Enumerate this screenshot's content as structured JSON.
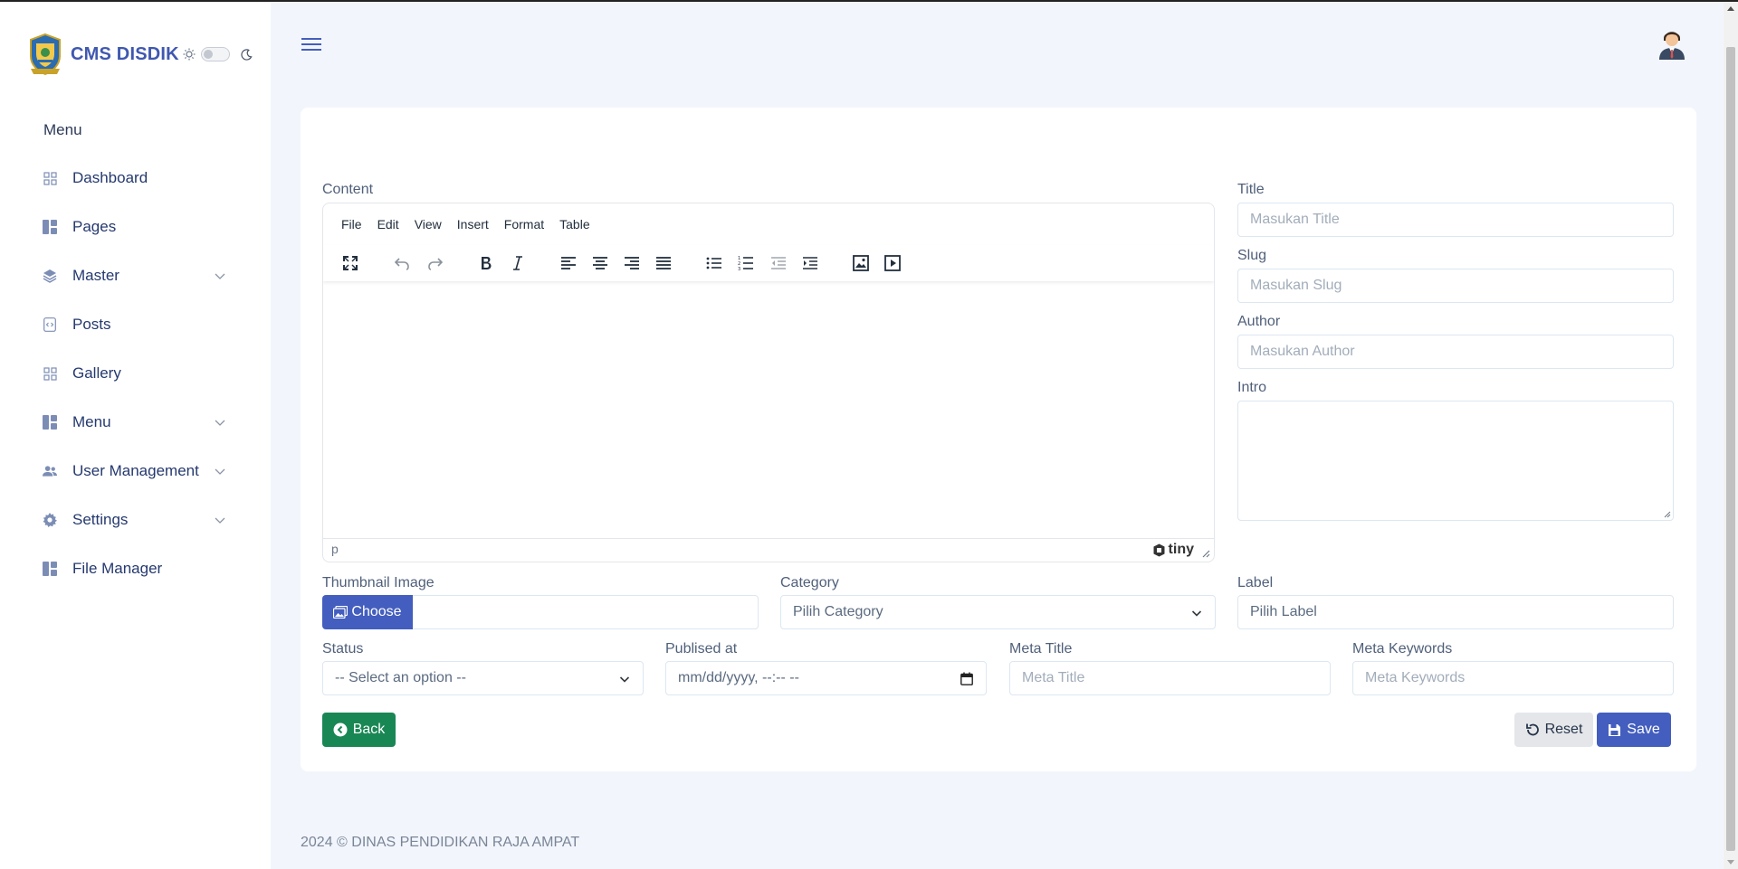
{
  "app": {
    "brand": "CMS DISDIK",
    "accent_color": "#435ebe",
    "success_color": "#198754"
  },
  "sidebar": {
    "menu_heading": "Menu",
    "items": [
      {
        "label": "Dashboard",
        "icon": "grid-icon",
        "has_submenu": false
      },
      {
        "label": "Pages",
        "icon": "layout-icon",
        "has_submenu": false
      },
      {
        "label": "Master",
        "icon": "layers-icon",
        "has_submenu": true
      },
      {
        "label": "Posts",
        "icon": "file-code-icon",
        "has_submenu": false
      },
      {
        "label": "Gallery",
        "icon": "grid-icon",
        "has_submenu": false
      },
      {
        "label": "Menu",
        "icon": "layout-icon",
        "has_submenu": true
      },
      {
        "label": "User Management",
        "icon": "people-icon",
        "has_submenu": true
      },
      {
        "label": "Settings",
        "icon": "gear-icon",
        "has_submenu": true
      },
      {
        "label": "File Manager",
        "icon": "layout-icon",
        "has_submenu": false
      }
    ]
  },
  "form": {
    "content_label": "Content",
    "editor": {
      "menus": [
        "File",
        "Edit",
        "View",
        "Insert",
        "Format",
        "Table"
      ],
      "status_path": "p",
      "brand": "tiny"
    },
    "title": {
      "label": "Title",
      "placeholder": "Masukan Title"
    },
    "slug": {
      "label": "Slug",
      "placeholder": "Masukan Slug"
    },
    "author": {
      "label": "Author",
      "placeholder": "Masukan Author"
    },
    "intro": {
      "label": "Intro"
    },
    "thumbnail": {
      "label": "Thumbnail Image",
      "button": "Choose"
    },
    "category": {
      "label": "Category",
      "value": "Pilih Category"
    },
    "label_field": {
      "label": "Label",
      "value": "Pilih Label"
    },
    "status": {
      "label": "Status",
      "value": "-- Select an option --"
    },
    "published_at": {
      "label": "Publised at",
      "value": "mm/dd/yyyy, --:-- --"
    },
    "meta_title": {
      "label": "Meta Title",
      "placeholder": "Meta Title"
    },
    "meta_keywords": {
      "label": "Meta Keywords",
      "placeholder": "Meta Keywords"
    },
    "buttons": {
      "back": "Back",
      "reset": "Reset",
      "save": "Save"
    }
  },
  "footer": {
    "text": "2024 © DINAS PENDIDIKAN RAJA AMPAT"
  }
}
